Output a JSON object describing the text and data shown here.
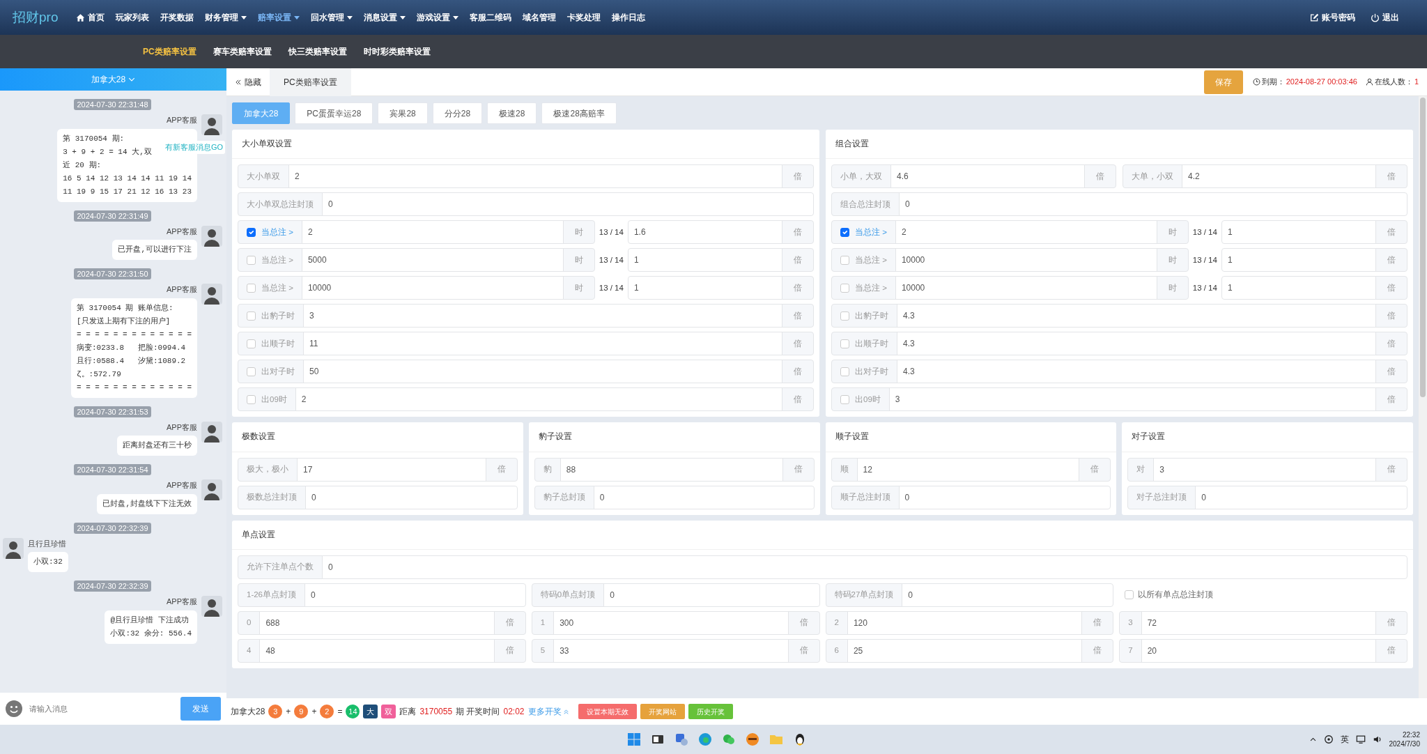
{
  "nav": {
    "logo": "招财pro",
    "items": [
      {
        "label": "首页",
        "dropdown": false,
        "selected": false
      },
      {
        "label": "玩家列表",
        "dropdown": false,
        "selected": false
      },
      {
        "label": "开奖数据",
        "dropdown": false,
        "selected": false
      },
      {
        "label": "财务管理",
        "dropdown": true,
        "selected": false
      },
      {
        "label": "赔率设置",
        "dropdown": true,
        "selected": true
      },
      {
        "label": "回水管理",
        "dropdown": true,
        "selected": false
      },
      {
        "label": "消息设置",
        "dropdown": true,
        "selected": false
      },
      {
        "label": "游戏设置",
        "dropdown": true,
        "selected": false
      },
      {
        "label": "客服二维码",
        "dropdown": false,
        "selected": false
      },
      {
        "label": "域名管理",
        "dropdown": false,
        "selected": false
      },
      {
        "label": "卡奖处理",
        "dropdown": false,
        "selected": false
      },
      {
        "label": "操作日志",
        "dropdown": false,
        "selected": false
      }
    ],
    "right_links": [
      {
        "label": "账号密码"
      },
      {
        "label": "退出"
      }
    ]
  },
  "subnav": [
    {
      "label": "PC类赔率设置",
      "selected": true
    },
    {
      "label": "赛车类赔率设置",
      "selected": false
    },
    {
      "label": "快三类赔率设置",
      "selected": false
    },
    {
      "label": "时时彩类赔率设置",
      "selected": false
    }
  ],
  "chat": {
    "title": "加拿大28",
    "new_message_tip": "有新客服消息GO",
    "messages": [
      {
        "time": "2024-07-30 22:31:48",
        "sender": "APP客服",
        "kind": "outgoing",
        "lines": [
          "第 3170054 期:",
          "3 + 9 + 2 = 14 大,双",
          "近 20 期:",
          "16 5 14 12 13 14 14 11 19 14",
          "11 19 9 15 17 21 12 16 13 23"
        ]
      },
      {
        "time": "2024-07-30 22:31:49",
        "sender": "APP客服",
        "kind": "outgoing",
        "lines": [
          "已开盘,可以进行下注"
        ]
      },
      {
        "time": "2024-07-30 22:31:50",
        "sender": "APP客服",
        "kind": "outgoing",
        "lines": [
          "第 3170054 期 账单信息:",
          "[只发送上期有下注的用户]",
          "= = = = = = = = = = = = =",
          "病变:0233.8   把脸:0994.4",
          "且行:0588.4   汐黛:1089.2",
          "ζ。:572.79",
          "= = = = = = = = = = = = ="
        ]
      },
      {
        "time": "2024-07-30 22:31:53",
        "sender": "APP客服",
        "kind": "outgoing",
        "lines": [
          "距离封盘还有三十秒"
        ]
      },
      {
        "time": "2024-07-30 22:31:54",
        "sender": "APP客服",
        "kind": "outgoing",
        "lines": [
          "已封盘,封盘线下下注无效"
        ]
      },
      {
        "time": "2024-07-30 22:32:39",
        "sender": "且行且珍惜",
        "kind": "incoming",
        "lines": [
          "小双:32"
        ]
      },
      {
        "time": "2024-07-30 22:32:39",
        "sender": "APP客服",
        "kind": "outgoing",
        "lines": [
          "@且行且珍惜 下注成功",
          "小双:32 余分: 556.4"
        ]
      }
    ],
    "input_placeholder": "请输入消息",
    "send": "发送"
  },
  "toolbar": {
    "hide": "隐藏",
    "tab": "PC类赔率设置",
    "save": "保存",
    "expire_label": "到期：",
    "expire": "2024-08-27 00:03:46",
    "online_label": "在线人数：",
    "online": "1"
  },
  "game_tabs": [
    {
      "label": "加拿大28",
      "selected": true
    },
    {
      "label": "PC蛋蛋幸运28",
      "selected": false
    },
    {
      "label": "宾果28",
      "selected": false
    },
    {
      "label": "分分28",
      "selected": false
    },
    {
      "label": "极速28",
      "selected": false
    },
    {
      "label": "极速28高赔率",
      "selected": false
    }
  ],
  "main_cards": [
    {
      "title": "大小单双设置",
      "rows": [
        {
          "kind": "field",
          "label": "大小单双",
          "value": "2",
          "unit": "倍"
        },
        {
          "kind": "field",
          "label": "大小单双总注封顶",
          "value": "0"
        },
        {
          "kind": "threshold",
          "checked": true,
          "label": "当总注 >",
          "value": "2",
          "unit": "时",
          "ratio": "13 / 14",
          "value2": "1.6",
          "unit2": "倍"
        },
        {
          "kind": "threshold",
          "checked": false,
          "label": "当总注 >",
          "value": "5000",
          "unit": "时",
          "ratio": "13 / 14",
          "value2": "1",
          "unit2": "倍"
        },
        {
          "kind": "threshold",
          "checked": false,
          "label": "当总注 >",
          "value": "10000",
          "unit": "时",
          "ratio": "13 / 14",
          "value2": "1",
          "unit2": "倍"
        },
        {
          "kind": "check",
          "checked": false,
          "label": "出豹子时",
          "value": "3",
          "unit": "倍"
        },
        {
          "kind": "check",
          "checked": false,
          "label": "出顺子时",
          "value": "11",
          "unit": "倍"
        },
        {
          "kind": "check",
          "checked": false,
          "label": "出对子时",
          "value": "50",
          "unit": "倍"
        },
        {
          "kind": "check",
          "checked": false,
          "label": "出09时",
          "value": "2",
          "unit": "倍"
        }
      ]
    },
    {
      "title": "组合设置",
      "rows": [
        {
          "kind": "pair",
          "items": [
            {
              "label": "小单，大双",
              "value": "4.6",
              "unit": "倍"
            },
            {
              "label": "大单，小双",
              "value": "4.2",
              "unit": "倍"
            }
          ]
        },
        {
          "kind": "field",
          "label": "组合总注封顶",
          "value": "0"
        },
        {
          "kind": "threshold",
          "checked": true,
          "label": "当总注 >",
          "value": "2",
          "unit": "时",
          "ratio": "13 / 14",
          "value2": "1",
          "unit2": "倍"
        },
        {
          "kind": "threshold",
          "checked": false,
          "label": "当总注 >",
          "value": "10000",
          "unit": "时",
          "ratio": "13 / 14",
          "value2": "1",
          "unit2": "倍"
        },
        {
          "kind": "threshold",
          "checked": false,
          "label": "当总注 >",
          "value": "10000",
          "unit": "时",
          "ratio": "13 / 14",
          "value2": "1",
          "unit2": "倍"
        },
        {
          "kind": "check",
          "checked": false,
          "label": "出豹子时",
          "value": "4.3",
          "unit": "倍"
        },
        {
          "kind": "check",
          "checked": false,
          "label": "出顺子时",
          "value": "4.3",
          "unit": "倍"
        },
        {
          "kind": "check",
          "checked": false,
          "label": "出对子时",
          "value": "4.3",
          "unit": "倍"
        },
        {
          "kind": "check",
          "checked": false,
          "label": "出09时",
          "value": "3",
          "unit": "倍"
        }
      ]
    }
  ],
  "small_cards": [
    {
      "title": "极数设置",
      "rows": [
        {
          "kind": "field",
          "label": "极大，极小",
          "value": "17",
          "unit": "倍"
        },
        {
          "kind": "field",
          "label": "极数总注封顶",
          "value": "0"
        }
      ]
    },
    {
      "title": "豹子设置",
      "rows": [
        {
          "kind": "field",
          "label": "豹",
          "value": "88",
          "unit": "倍"
        },
        {
          "kind": "field",
          "label": "豹子总封顶",
          "value": "0"
        }
      ]
    },
    {
      "title": "顺子设置",
      "rows": [
        {
          "kind": "field",
          "label": "顺",
          "value": "12",
          "unit": "倍"
        },
        {
          "kind": "field",
          "label": "顺子总注封顶",
          "value": "0"
        }
      ]
    },
    {
      "title": "对子设置",
      "rows": [
        {
          "kind": "field",
          "label": "对",
          "value": "3",
          "unit": "倍"
        },
        {
          "kind": "field",
          "label": "对子总注封顶",
          "value": "0"
        }
      ]
    }
  ],
  "single_card": {
    "title": "单点设置",
    "rows": [
      {
        "kind": "field",
        "label": "允许下注单点个数",
        "value": "0"
      },
      {
        "kind": "caps",
        "items": [
          {
            "label": "1-26单点封顶",
            "value": "0"
          },
          {
            "label": "特码0单点封顶",
            "value": "0"
          },
          {
            "label": "特码27单点封顶",
            "value": "0"
          }
        ],
        "check": {
          "checked": false,
          "label": "以所有单点总注封顶"
        }
      },
      {
        "kind": "points",
        "items": [
          {
            "label": "0",
            "value": "688",
            "unit": "倍"
          },
          {
            "label": "1",
            "value": "300",
            "unit": "倍"
          },
          {
            "label": "2",
            "value": "120",
            "unit": "倍"
          },
          {
            "label": "3",
            "value": "72",
            "unit": "倍"
          }
        ]
      },
      {
        "kind": "points",
        "items": [
          {
            "label": "4",
            "value": "48",
            "unit": "倍"
          },
          {
            "label": "5",
            "value": "33",
            "unit": "倍"
          },
          {
            "label": "6",
            "value": "25",
            "unit": "倍"
          },
          {
            "label": "7",
            "value": "20",
            "unit": "倍"
          }
        ]
      }
    ]
  },
  "status_bar": [
    {
      "kind": "text",
      "text": "加拿大28"
    },
    {
      "kind": "ball",
      "text": "3",
      "color": "#f47c3c"
    },
    {
      "kind": "op",
      "text": "+"
    },
    {
      "kind": "ball",
      "text": "9",
      "color": "#f47c3c"
    },
    {
      "kind": "op",
      "text": "+"
    },
    {
      "kind": "ball",
      "text": "2",
      "color": "#f47c3c"
    },
    {
      "kind": "op",
      "text": "="
    },
    {
      "kind": "ball",
      "text": "14",
      "color": "#19be6b"
    },
    {
      "kind": "tag",
      "text": "大",
      "color": "#1f4e79"
    },
    {
      "kind": "tag",
      "text": "双",
      "color": "#f0609a"
    },
    {
      "kind": "text",
      "text": "距离"
    },
    {
      "kind": "alert",
      "text": "3170055"
    },
    {
      "kind": "text",
      "text": "期 开奖时间"
    },
    {
      "kind": "alert",
      "text": "02:02"
    },
    {
      "kind": "link",
      "text": "更多开奖"
    },
    {
      "kind": "button",
      "text": "设置本期无效",
      "color": "#f56c6c"
    },
    {
      "kind": "button",
      "text": "开奖网站",
      "color": "#e6a23c"
    },
    {
      "kind": "button",
      "text": "历史开奖",
      "color": "#67c23a"
    }
  ],
  "taskbar": {
    "ime": "英",
    "time": "22:32",
    "date": "2024/7/30"
  }
}
